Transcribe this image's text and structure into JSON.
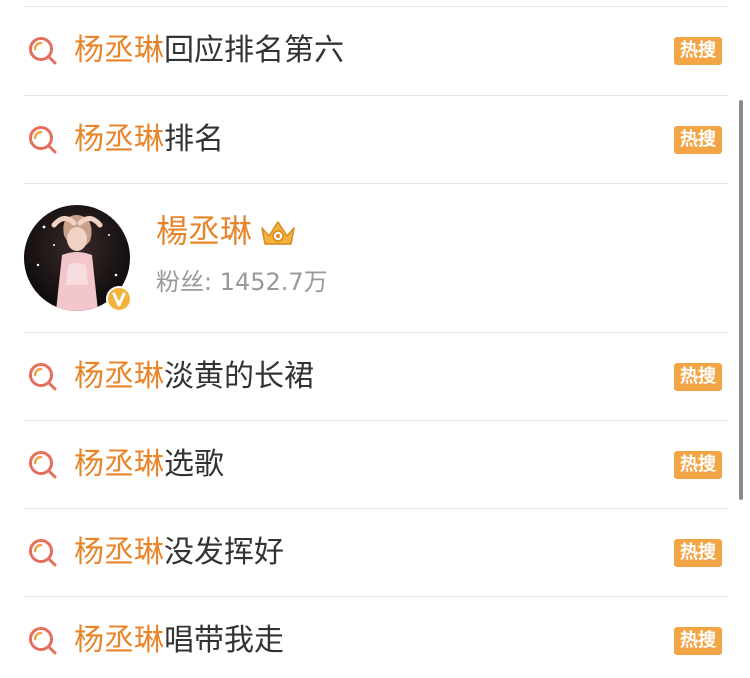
{
  "search_list": {
    "items": [
      {
        "keyword": "杨丞琳",
        "suffix": "回应排名第六",
        "badge": "热搜"
      },
      {
        "keyword": "杨丞琳",
        "suffix": "排名",
        "badge": "热搜"
      },
      {
        "keyword": "杨丞琳",
        "suffix": "淡黄的长裙",
        "badge": "热搜"
      },
      {
        "keyword": "杨丞琳",
        "suffix": "选歌",
        "badge": "热搜"
      },
      {
        "keyword": "杨丞琳",
        "suffix": "没发挥好",
        "badge": "热搜"
      },
      {
        "keyword": "杨丞琳",
        "suffix": "唱带我走",
        "badge": "热搜"
      }
    ]
  },
  "user_card": {
    "name": "楊丞琳",
    "fans_text": "粉丝: 1452.7万"
  },
  "colors": {
    "keyword": "#e8852a",
    "badge_bg": "#f3a545",
    "text": "#333333",
    "muted": "#999999"
  }
}
